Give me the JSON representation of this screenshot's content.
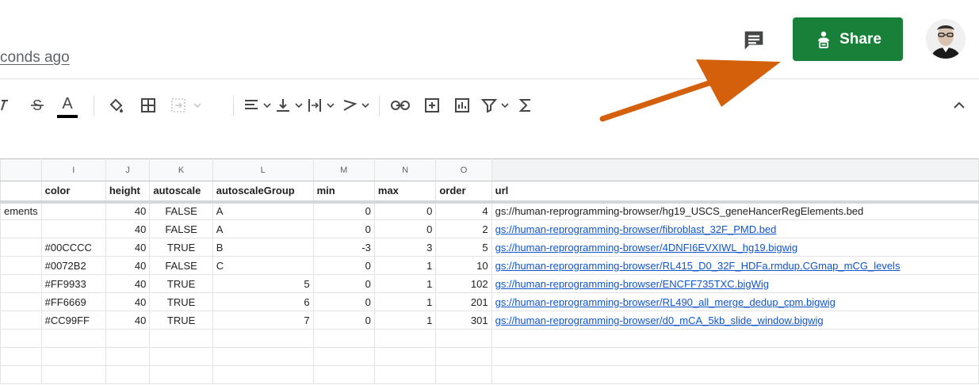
{
  "header": {
    "saved_status": "conds ago",
    "share_label": "Share",
    "comment_icon": "comment-icon",
    "avatar": "user-avatar"
  },
  "toolbar": {
    "items": [
      {
        "name": "strikethrough-icon"
      },
      {
        "name": "text-color-icon",
        "color": "#000000"
      },
      {
        "name": "fill-color-icon"
      },
      {
        "name": "borders-icon"
      },
      {
        "name": "merge-cells-icon"
      },
      {
        "name": "horizontal-align-icon"
      },
      {
        "name": "vertical-align-icon"
      },
      {
        "name": "text-wrapping-icon"
      },
      {
        "name": "text-rotation-icon"
      },
      {
        "name": "insert-link-icon"
      },
      {
        "name": "insert-comment-icon"
      },
      {
        "name": "insert-chart-icon"
      },
      {
        "name": "create-filter-icon"
      },
      {
        "name": "functions-icon"
      }
    ],
    "collapse_icon": "chevron-up-icon"
  },
  "annotation": {
    "arrow_color": "#d4600c",
    "points_to": "share-button"
  },
  "sheet": {
    "column_letters": [
      "",
      "I",
      "J",
      "K",
      "L",
      "M",
      "N",
      "O",
      ""
    ],
    "header_row": [
      "",
      "color",
      "height",
      "autoscale",
      "autoscaleGroup",
      "min",
      "max",
      "order",
      "url"
    ],
    "rows": [
      [
        "ements",
        "",
        "40",
        "FALSE",
        "A",
        "0",
        "0",
        "4",
        "gs://human-reprogramming-browser/hg19_USCS_geneHancerRegElements.bed"
      ],
      [
        "",
        "",
        "40",
        "FALSE",
        "A",
        "0",
        "0",
        "2",
        "gs://human-reprogramming-browser/fibroblast_32F_PMD.bed"
      ],
      [
        "",
        "#00CCCC",
        "40",
        "TRUE",
        "B",
        "-3",
        "3",
        "5",
        "gs://human-reprogramming-browser/4DNFI6EVXIWL_hg19.bigwig"
      ],
      [
        "",
        "#0072B2",
        "40",
        "FALSE",
        "C",
        "0",
        "1",
        "10",
        "gs://human-reprogramming-browser/RL415_D0_32F_HDFa.rmdup.CGmap_mCG_levels"
      ],
      [
        "",
        "#FF9933",
        "40",
        "TRUE",
        "5",
        "0",
        "1",
        "102",
        "gs://human-reprogramming-browser/ENCFF735TXC.bigWig"
      ],
      [
        "",
        "#FF6669",
        "40",
        "TRUE",
        "6",
        "0",
        "1",
        "201",
        "gs://human-reprogramming-browser/RL490_all_merge_dedup_cpm.bigwig"
      ],
      [
        "",
        "#CC99FF",
        "40",
        "TRUE",
        "7",
        "0",
        "1",
        "301",
        "gs://human-reprogramming-browser/d0_mCA_5kb_slide_window.bigwig"
      ],
      [
        "",
        "",
        "",
        "",
        "",
        "",
        "",
        "",
        ""
      ],
      [
        "",
        "",
        "",
        "",
        "",
        "",
        "",
        "",
        ""
      ],
      [
        "",
        "",
        "",
        "",
        "",
        "",
        "",
        "",
        ""
      ]
    ],
    "link_rows": [
      1,
      2,
      3,
      4,
      5,
      6
    ]
  }
}
